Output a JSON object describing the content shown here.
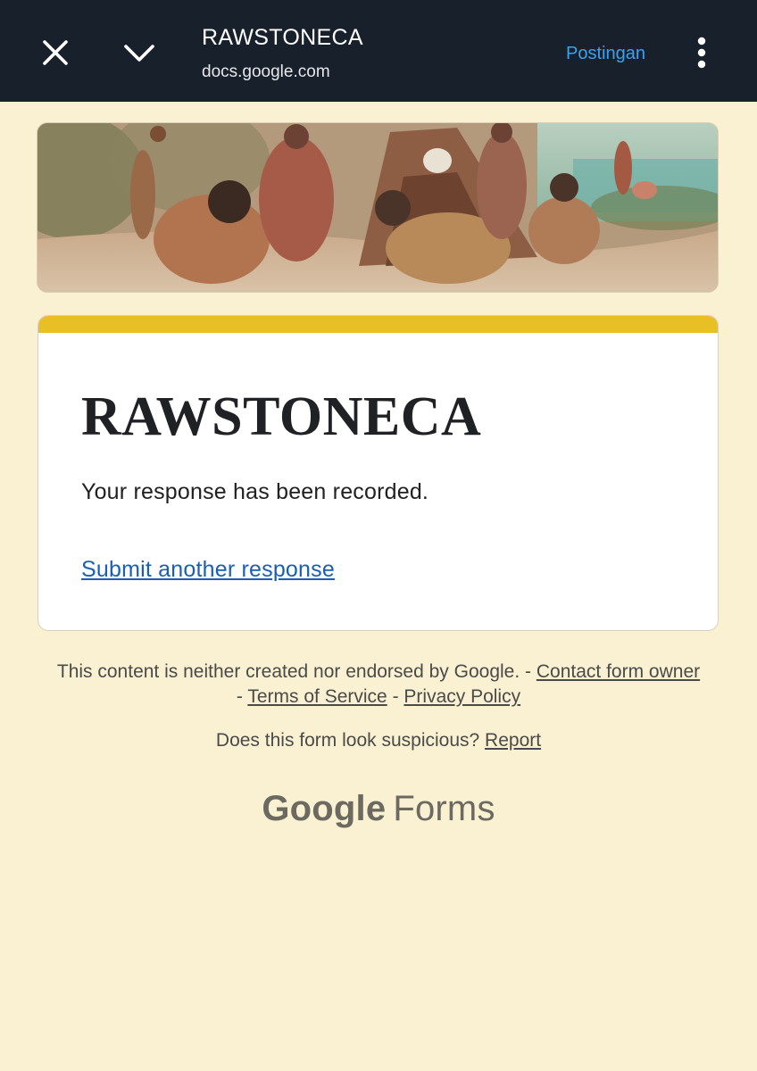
{
  "browser_bar": {
    "title": "RAWSTONECA",
    "url": "docs.google.com",
    "action_label": "Postingan",
    "icons": [
      "close-icon",
      "chevron-down-icon",
      "more-vert-icon"
    ]
  },
  "form": {
    "accent_color": "#e8bf25",
    "title": "RAWSTONECA",
    "confirmation": "Your response has been recorded.",
    "submit_another": "Submit another response"
  },
  "footer": {
    "disclaimer": "This content is neither created nor endorsed by Google.",
    "sep": "-",
    "contact_link": "Contact form owner",
    "terms_link": "Terms of Service",
    "privacy_link": "Privacy Policy",
    "suspicious_q": "Does this form look suspicious?",
    "report_link": "Report",
    "brand_google": "Google",
    "brand_forms": "Forms"
  },
  "colors": {
    "page_bg": "#faf1d2",
    "bar_bg": "#18212b",
    "link": "#1a5fb4"
  }
}
